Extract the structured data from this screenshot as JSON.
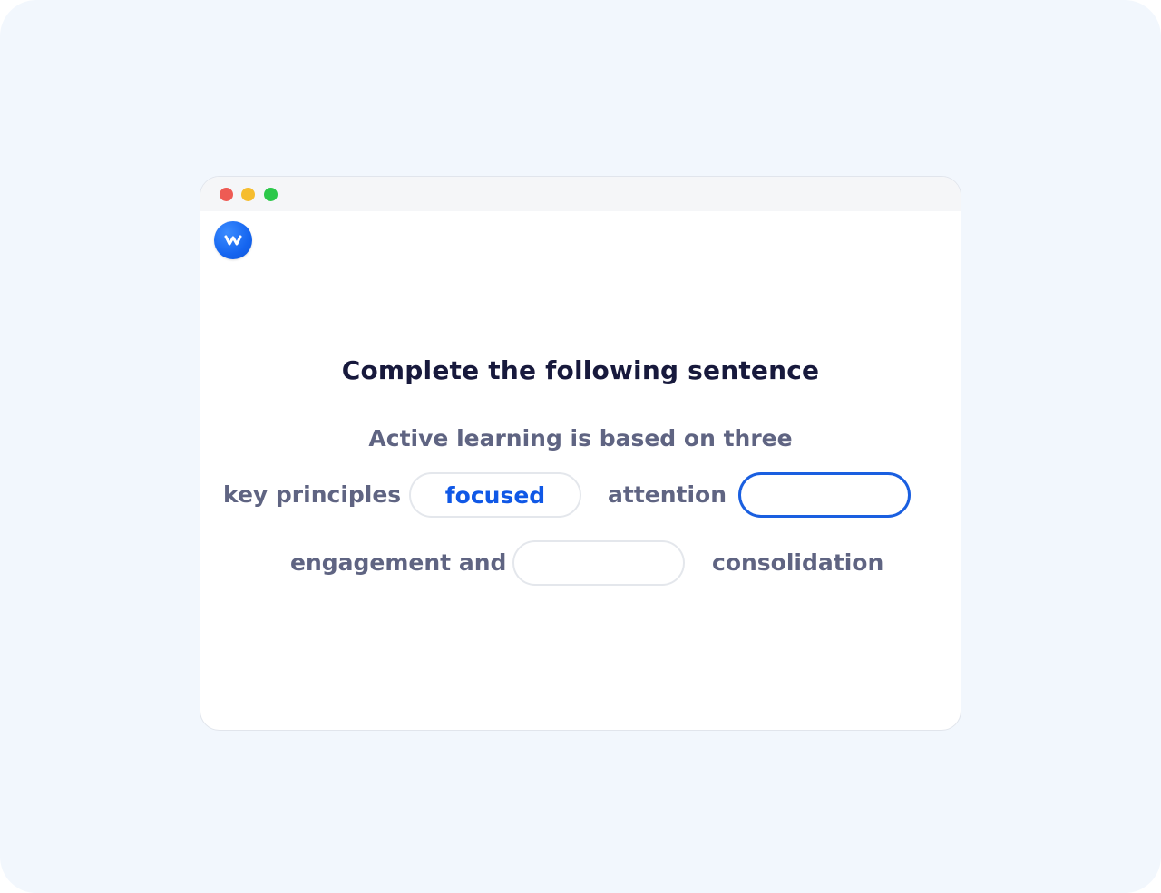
{
  "quiz": {
    "heading": "Complete the following sentence",
    "line1": "Active learning is based on three",
    "word_key_principles": "key principles",
    "blank1_value": "focused",
    "word_attention": "attention",
    "blank2_value": "",
    "word_engagement_and": "engagement and",
    "blank3_value": "",
    "word_consolidation": "consolidation"
  },
  "colors": {
    "background": "#f2f7fd",
    "accent": "#1058e6",
    "heading": "#17193c",
    "body_text": "#5f6482"
  },
  "icons": {
    "logo": "w-logo-icon"
  }
}
